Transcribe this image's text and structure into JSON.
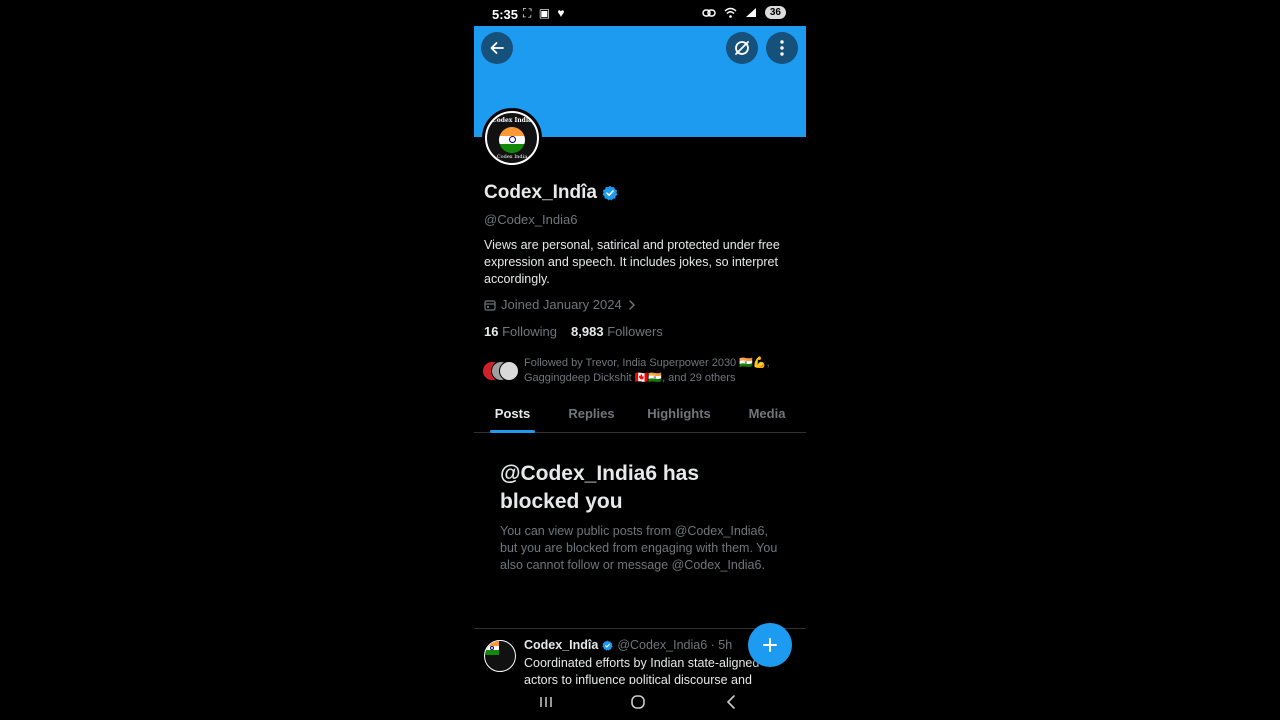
{
  "status_bar": {
    "time": "5:35",
    "left_icons": "⛶ ▣ ♥",
    "battery": "36"
  },
  "profile": {
    "display_name": "Codex_Indîa",
    "handle": "@Codex_India6",
    "bio": "Views are personal, satirical and protected under free expression and speech. It includes jokes, so interpret accordingly.",
    "joined": "Joined January 2024",
    "following_count": "16",
    "following_label": "Following",
    "followers_count": "8,983",
    "followers_label": "Followers",
    "followed_by": "Followed by Trevor, India Superpower 2030 🇮🇳💪, Gaggingdeep Dickshit 🇨🇦🇮🇳, and 29 others",
    "avatar_text_top": "Codex India",
    "avatar_text_bottom": "Codex   India"
  },
  "tabs": [
    {
      "label": "Posts",
      "active": true
    },
    {
      "label": "Replies",
      "active": false
    },
    {
      "label": "Highlights",
      "active": false
    },
    {
      "label": "Media",
      "active": false
    }
  ],
  "blocked": {
    "title": "@Codex_India6 has blocked you",
    "description": "You can view public posts from @Codex_India6, but you are blocked from engaging with them. You also cannot follow or message @Codex_India6."
  },
  "tweet": {
    "name": "Codex_Indîa",
    "meta": "@Codex_India6 · 5h",
    "text": "Coordinated efforts by Indian state-aligned actors to influence political discourse and"
  },
  "colors": {
    "banner": "#1d9bf0",
    "accent": "#1d9bf0",
    "background": "#000000",
    "muted_text": "#71767b"
  },
  "icons": {
    "back": "arrow-left-icon",
    "grok": "grok-icon",
    "more": "more-vertical-icon",
    "verified": "verified-badge-icon",
    "calendar": "calendar-icon",
    "compose": "plus-icon"
  }
}
